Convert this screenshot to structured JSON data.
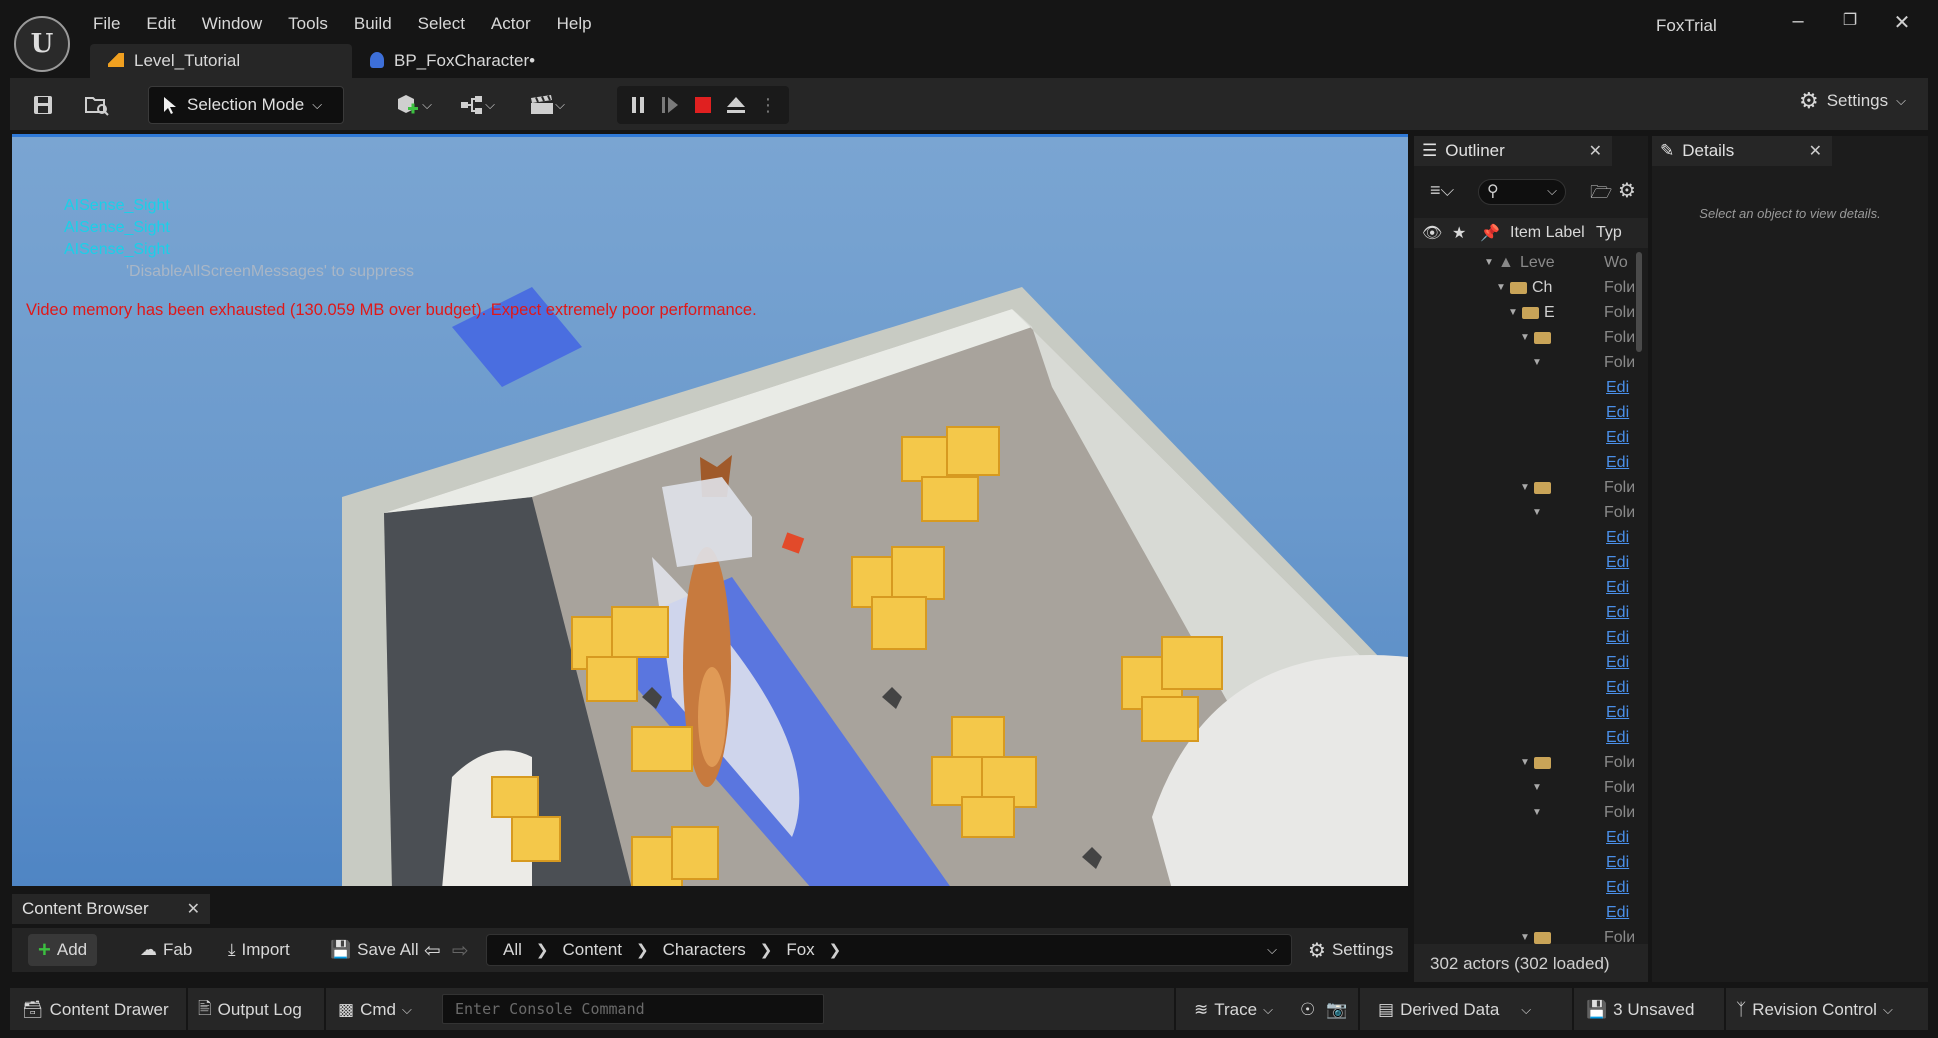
{
  "menu": [
    "File",
    "Edit",
    "Window",
    "Tools",
    "Build",
    "Select",
    "Actor",
    "Help"
  ],
  "app_title": "FoxTrial",
  "tabs": [
    {
      "label": "Level_Tutorial",
      "active": true
    },
    {
      "label": "BP_FoxCharacter•",
      "active": false
    }
  ],
  "toolbar": {
    "selection_mode": "Selection Mode",
    "settings": "Settings"
  },
  "viewport": {
    "messages": [
      "AISense_Sight",
      "AISense_Sight",
      "AISense_Sight"
    ],
    "suppress_hint": "'DisableAllScreenMessages' to suppress",
    "warning": "Video memory has been exhausted (130.059 MB over budget). Expect extremely poor performance."
  },
  "outliner": {
    "title": "Outliner",
    "col_label": "Item Label",
    "col_type": "Typ",
    "rows": [
      {
        "indent": 3,
        "kind": "level",
        "label": "Leve",
        "type": "Wo"
      },
      {
        "indent": 4,
        "kind": "folder",
        "label": "Ch",
        "type": "Folи"
      },
      {
        "indent": 5,
        "kind": "folder",
        "label": "E",
        "type": "Folи"
      },
      {
        "indent": 6,
        "kind": "folder",
        "label": "",
        "type": "Folи"
      },
      {
        "indent": 7,
        "kind": "item",
        "label": "",
        "type": "Folи"
      },
      {
        "indent": 8,
        "kind": "link",
        "label": "",
        "type": "Edi"
      },
      {
        "indent": 8,
        "kind": "link",
        "label": "",
        "type": "Edi"
      },
      {
        "indent": 8,
        "kind": "link",
        "label": "",
        "type": "Edi"
      },
      {
        "indent": 8,
        "kind": "link",
        "label": "",
        "type": "Edi"
      },
      {
        "indent": 6,
        "kind": "folder",
        "label": "",
        "type": "Folи"
      },
      {
        "indent": 7,
        "kind": "item",
        "label": "",
        "type": "Folи"
      },
      {
        "indent": 8,
        "kind": "link",
        "label": "",
        "type": "Edi"
      },
      {
        "indent": 8,
        "kind": "link",
        "label": "",
        "type": "Edi"
      },
      {
        "indent": 8,
        "kind": "link",
        "label": "",
        "type": "Edi"
      },
      {
        "indent": 8,
        "kind": "link",
        "label": "",
        "type": "Edi"
      },
      {
        "indent": 8,
        "kind": "link",
        "label": "",
        "type": "Edi"
      },
      {
        "indent": 8,
        "kind": "link",
        "label": "",
        "type": "Edi"
      },
      {
        "indent": 8,
        "kind": "link",
        "label": "",
        "type": "Edi"
      },
      {
        "indent": 8,
        "kind": "link",
        "label": "",
        "type": "Edi"
      },
      {
        "indent": 8,
        "kind": "link",
        "label": "",
        "type": "Edi"
      },
      {
        "indent": 6,
        "kind": "folder",
        "label": "",
        "type": "Folи"
      },
      {
        "indent": 7,
        "kind": "item",
        "label": "",
        "type": "Folи"
      },
      {
        "indent": 7,
        "kind": "item",
        "label": "",
        "type": "Folи"
      },
      {
        "indent": 8,
        "kind": "link",
        "label": "",
        "type": "Edi"
      },
      {
        "indent": 8,
        "kind": "link",
        "label": "",
        "type": "Edi"
      },
      {
        "indent": 8,
        "kind": "link",
        "label": "",
        "type": "Edi"
      },
      {
        "indent": 8,
        "kind": "link",
        "label": "",
        "type": "Edi"
      },
      {
        "indent": 6,
        "kind": "folder",
        "label": "",
        "type": "Folи"
      }
    ],
    "footer": "302 actors (302 loaded)"
  },
  "details": {
    "title": "Details",
    "empty_text": "Select an object to view details."
  },
  "content_browser": {
    "title": "Content Browser",
    "add": "Add",
    "fab": "Fab",
    "import": "Import",
    "save_all": "Save All",
    "breadcrumbs": [
      "All",
      "Content",
      "Characters",
      "Fox"
    ],
    "settings": "Settings"
  },
  "statusbar": {
    "content_drawer": "Content Drawer",
    "output_log": "Output Log",
    "cmd": "Cmd",
    "console_placeholder": "Enter Console Command",
    "trace": "Trace",
    "derived_data": "Derived Data",
    "unsaved": "3 Unsaved",
    "revision_control": "Revision Control"
  },
  "colors": {
    "accent_blue": "#2f7ad9",
    "warning_red": "#e01818",
    "ai_cyan": "#1ad0e8",
    "link_blue": "#4a8fe8"
  }
}
